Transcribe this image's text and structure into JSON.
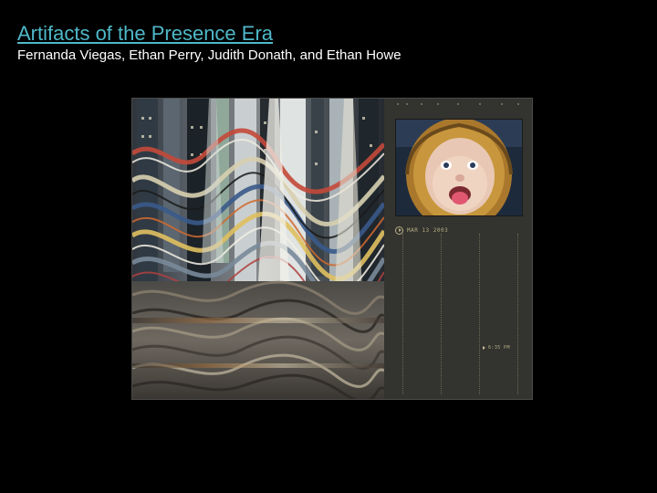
{
  "slide": {
    "title": "Artifacts of the Presence Era",
    "authors": "Fernanda Viegas, Ethan Perry, Judith Donath, and Ethan Howe"
  },
  "artifact": {
    "date_label": "MAR 13 2003",
    "time_label": "6:35 PM",
    "icons": {
      "play": "play-circle-icon",
      "time_marker": "triangle-marker-icon"
    }
  },
  "colors": {
    "background": "#000000",
    "title_link": "#4fb8c8",
    "authors_text": "#ffffff",
    "panel": "#33332f",
    "panel_text": "#b6ae86"
  }
}
